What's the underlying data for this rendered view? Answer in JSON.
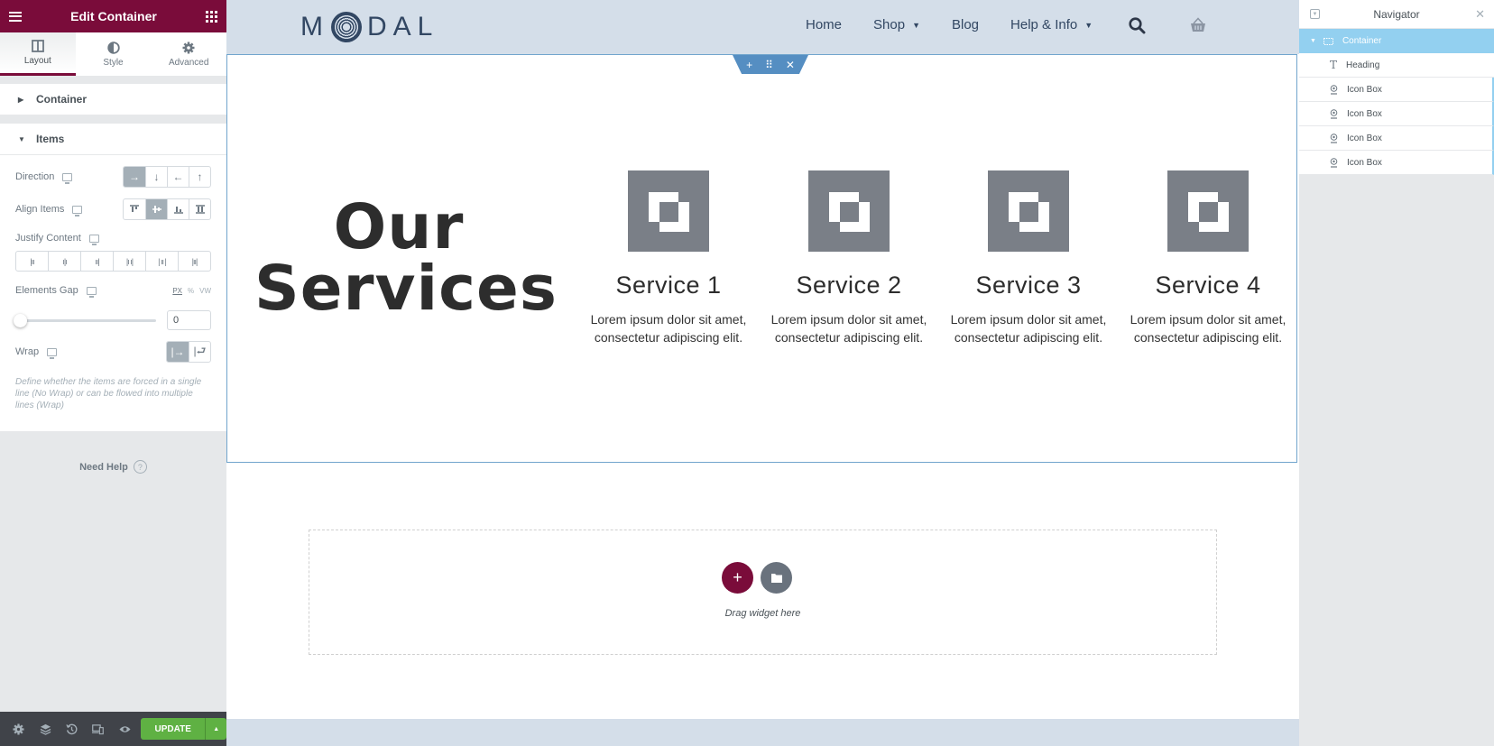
{
  "panel": {
    "title": "Edit Container",
    "tabs": [
      {
        "label": "Layout",
        "icon": "layout-icon",
        "active": true
      },
      {
        "label": "Style",
        "icon": "half-circle-icon",
        "active": false
      },
      {
        "label": "Advanced",
        "icon": "gear-icon",
        "active": false
      }
    ],
    "sections": {
      "container": "Container",
      "items": "Items"
    },
    "controls": {
      "direction": {
        "label": "Direction",
        "options": [
          "→",
          "↓",
          "←",
          "↑"
        ],
        "selected": 0
      },
      "align_items": {
        "label": "Align Items",
        "options": [
          "top",
          "center",
          "bottom",
          "stretch"
        ],
        "selected": 1
      },
      "justify_content": {
        "label": "Justify Content",
        "options": [
          "start",
          "center",
          "end",
          "space-between",
          "space-around",
          "space-evenly"
        ]
      },
      "elements_gap": {
        "label": "Elements Gap",
        "units": [
          "PX",
          "%",
          "VW"
        ],
        "selected_unit": "PX",
        "value": "0",
        "slider_fraction": 0
      },
      "wrap": {
        "label": "Wrap",
        "options": [
          "no-wrap",
          "wrap"
        ],
        "selected": 0
      },
      "wrap_description": "Define whether the items are forced in a single line (No Wrap) or can be flowed into multiple lines (Wrap)"
    },
    "need_help": "Need Help",
    "footer": {
      "update_label": "UPDATE",
      "icons": [
        "settings-icon",
        "layers-icon",
        "history-icon",
        "responsive-icon",
        "preview-icon"
      ]
    }
  },
  "site": {
    "logo": {
      "before": "M",
      "after": "DAL"
    },
    "nav": [
      {
        "label": "Home",
        "dropdown": false
      },
      {
        "label": "Shop",
        "dropdown": true
      },
      {
        "label": "Blog",
        "dropdown": false
      },
      {
        "label": "Help & Info",
        "dropdown": true
      }
    ],
    "heading_line1": "Our",
    "heading_line2": "Services",
    "services": [
      {
        "title": "Service 1",
        "text": "Lorem ipsum dolor sit amet, consectetur adipiscing elit."
      },
      {
        "title": "Service 2",
        "text": "Lorem ipsum dolor sit amet, consectetur adipiscing elit."
      },
      {
        "title": "Service 3",
        "text": "Lorem ipsum dolor sit amet, consectetur adipiscing elit."
      },
      {
        "title": "Service 4",
        "text": "Lorem ipsum dolor sit amet, consectetur adipiscing elit."
      }
    ],
    "container_handle": {
      "add": "+",
      "move": "⠿",
      "delete": "✕"
    },
    "dropzone": {
      "add": "+",
      "text": "Drag widget here"
    }
  },
  "navigator": {
    "title": "Navigator",
    "root": "Container",
    "children": [
      "Heading",
      "Icon Box",
      "Icon Box",
      "Icon Box",
      "Icon Box"
    ]
  },
  "colors": {
    "brand": "#7a0c3a",
    "update_green": "#5fb143",
    "selection_blue": "#93d0f0",
    "header_bg": "#d4dee9"
  }
}
